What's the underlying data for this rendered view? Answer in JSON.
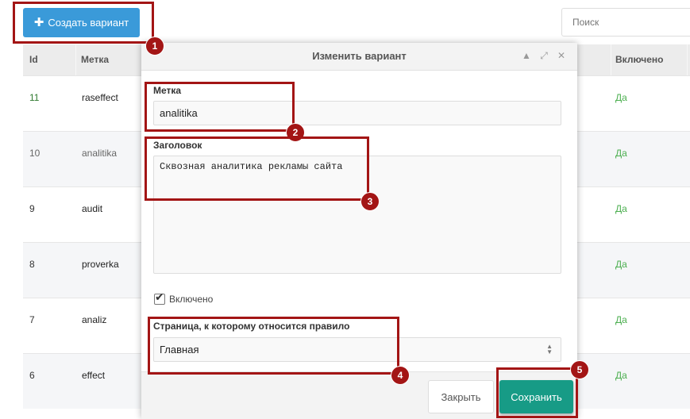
{
  "toolbar": {
    "create_button_label": "Создать вариант",
    "create_button_icon": "plus-icon"
  },
  "search": {
    "placeholder": "Поиск"
  },
  "table": {
    "headers": {
      "id": "Id",
      "label": "Метка",
      "enabled": "Включено"
    },
    "rows": [
      {
        "id": "11",
        "label": "raseffect",
        "enabled": "Да"
      },
      {
        "id": "10",
        "label": "analitika",
        "enabled": "Да"
      },
      {
        "id": "9",
        "label": "audit",
        "enabled": "Да"
      },
      {
        "id": "8",
        "label": "proverka",
        "enabled": "Да"
      },
      {
        "id": "7",
        "label": "analiz",
        "enabled": "Да"
      },
      {
        "id": "6",
        "label": "effect",
        "enabled": "Да"
      }
    ]
  },
  "modal": {
    "title": "Изменить вариант",
    "header_icons": [
      "chevron-up-icon",
      "expand-icon",
      "close-icon"
    ],
    "label_field": {
      "label": "Метка",
      "value": "analitika"
    },
    "heading_field": {
      "label": "Заголовок",
      "value": "Сквозная аналитика рекламы сайта"
    },
    "enabled_checkbox": {
      "label": "Включено",
      "checked": true
    },
    "page_field": {
      "label": "Страница, к которому относится правило",
      "value": "Главная"
    },
    "close_button": "Закрыть",
    "save_button": "Сохранить"
  },
  "callouts": [
    "1",
    "2",
    "3",
    "4",
    "5"
  ],
  "colors": {
    "primary": "#3a9ad9",
    "save": "#179b86",
    "callout": "#a31515",
    "enabled_text": "#4caf50"
  }
}
